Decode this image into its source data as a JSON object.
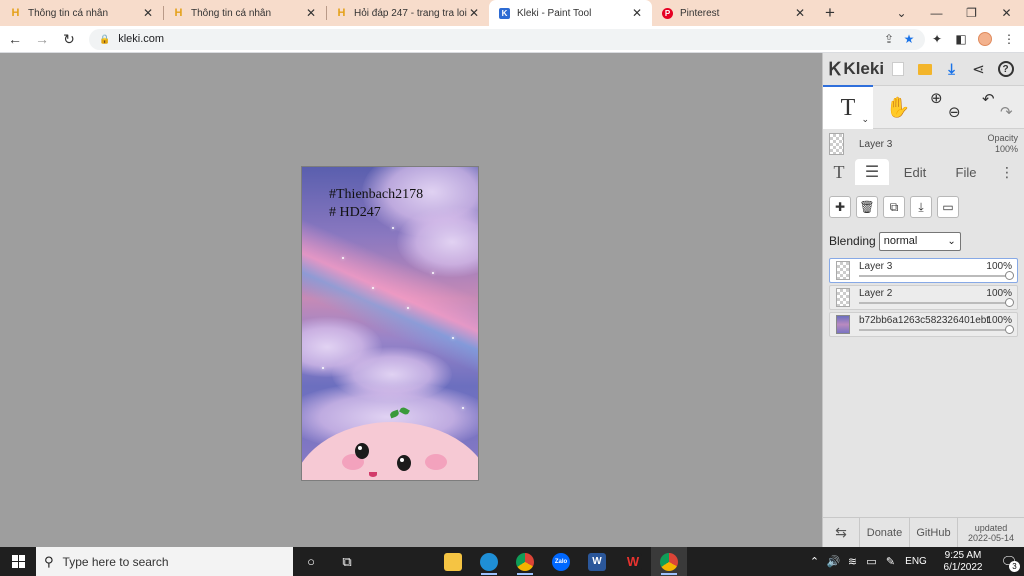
{
  "browser": {
    "tabs": [
      {
        "title": "Thông tin cá nhân",
        "favicon": "H",
        "close": "✕"
      },
      {
        "title": "Thông tin cá nhân",
        "favicon": "H",
        "close": "✕"
      },
      {
        "title": "Hỏi đáp 247 - trang tra loi",
        "favicon": "H",
        "close": "✕"
      },
      {
        "title": "Kleki - Paint Tool",
        "favicon": "K",
        "close": "✕"
      },
      {
        "title": "Pinterest",
        "favicon": "P",
        "close": "✕"
      }
    ],
    "new_tab": "+",
    "url": "kleki.com",
    "active_tab_index": 3
  },
  "artwork": {
    "text_line1": "#Thienbach2178",
    "text_line2": "# HD247"
  },
  "kleki": {
    "logo_text": "Kleki",
    "current_layer_name": "Layer 3",
    "opacity_label": "Opacity",
    "opacity_value": "100%",
    "tabs": {
      "text": "T",
      "edit": "Edit",
      "file": "File"
    },
    "blending_label": "Blending",
    "blending_value": "normal",
    "layers": [
      {
        "name": "Layer 3",
        "opacity": "100%",
        "active": true
      },
      {
        "name": "Layer 2",
        "opacity": "100%",
        "active": false
      },
      {
        "name": "b72bb6a1263c582326401ebt",
        "opacity": "100%",
        "active": false
      }
    ],
    "footer": {
      "donate": "Donate",
      "github": "GitHub",
      "updated_label": "updated",
      "updated_date": "2022-05-14"
    }
  },
  "taskbar": {
    "search_placeholder": "Type here to search",
    "language": "ENG",
    "time": "9:25 AM",
    "date": "6/1/2022",
    "notification_count": "3"
  },
  "colors": {
    "kleki_accent": "#2f6fdb",
    "tab_strip": "#f7dccb",
    "canvas_bg": "#9e9e9e",
    "panel_bg": "#e4e4e4"
  }
}
